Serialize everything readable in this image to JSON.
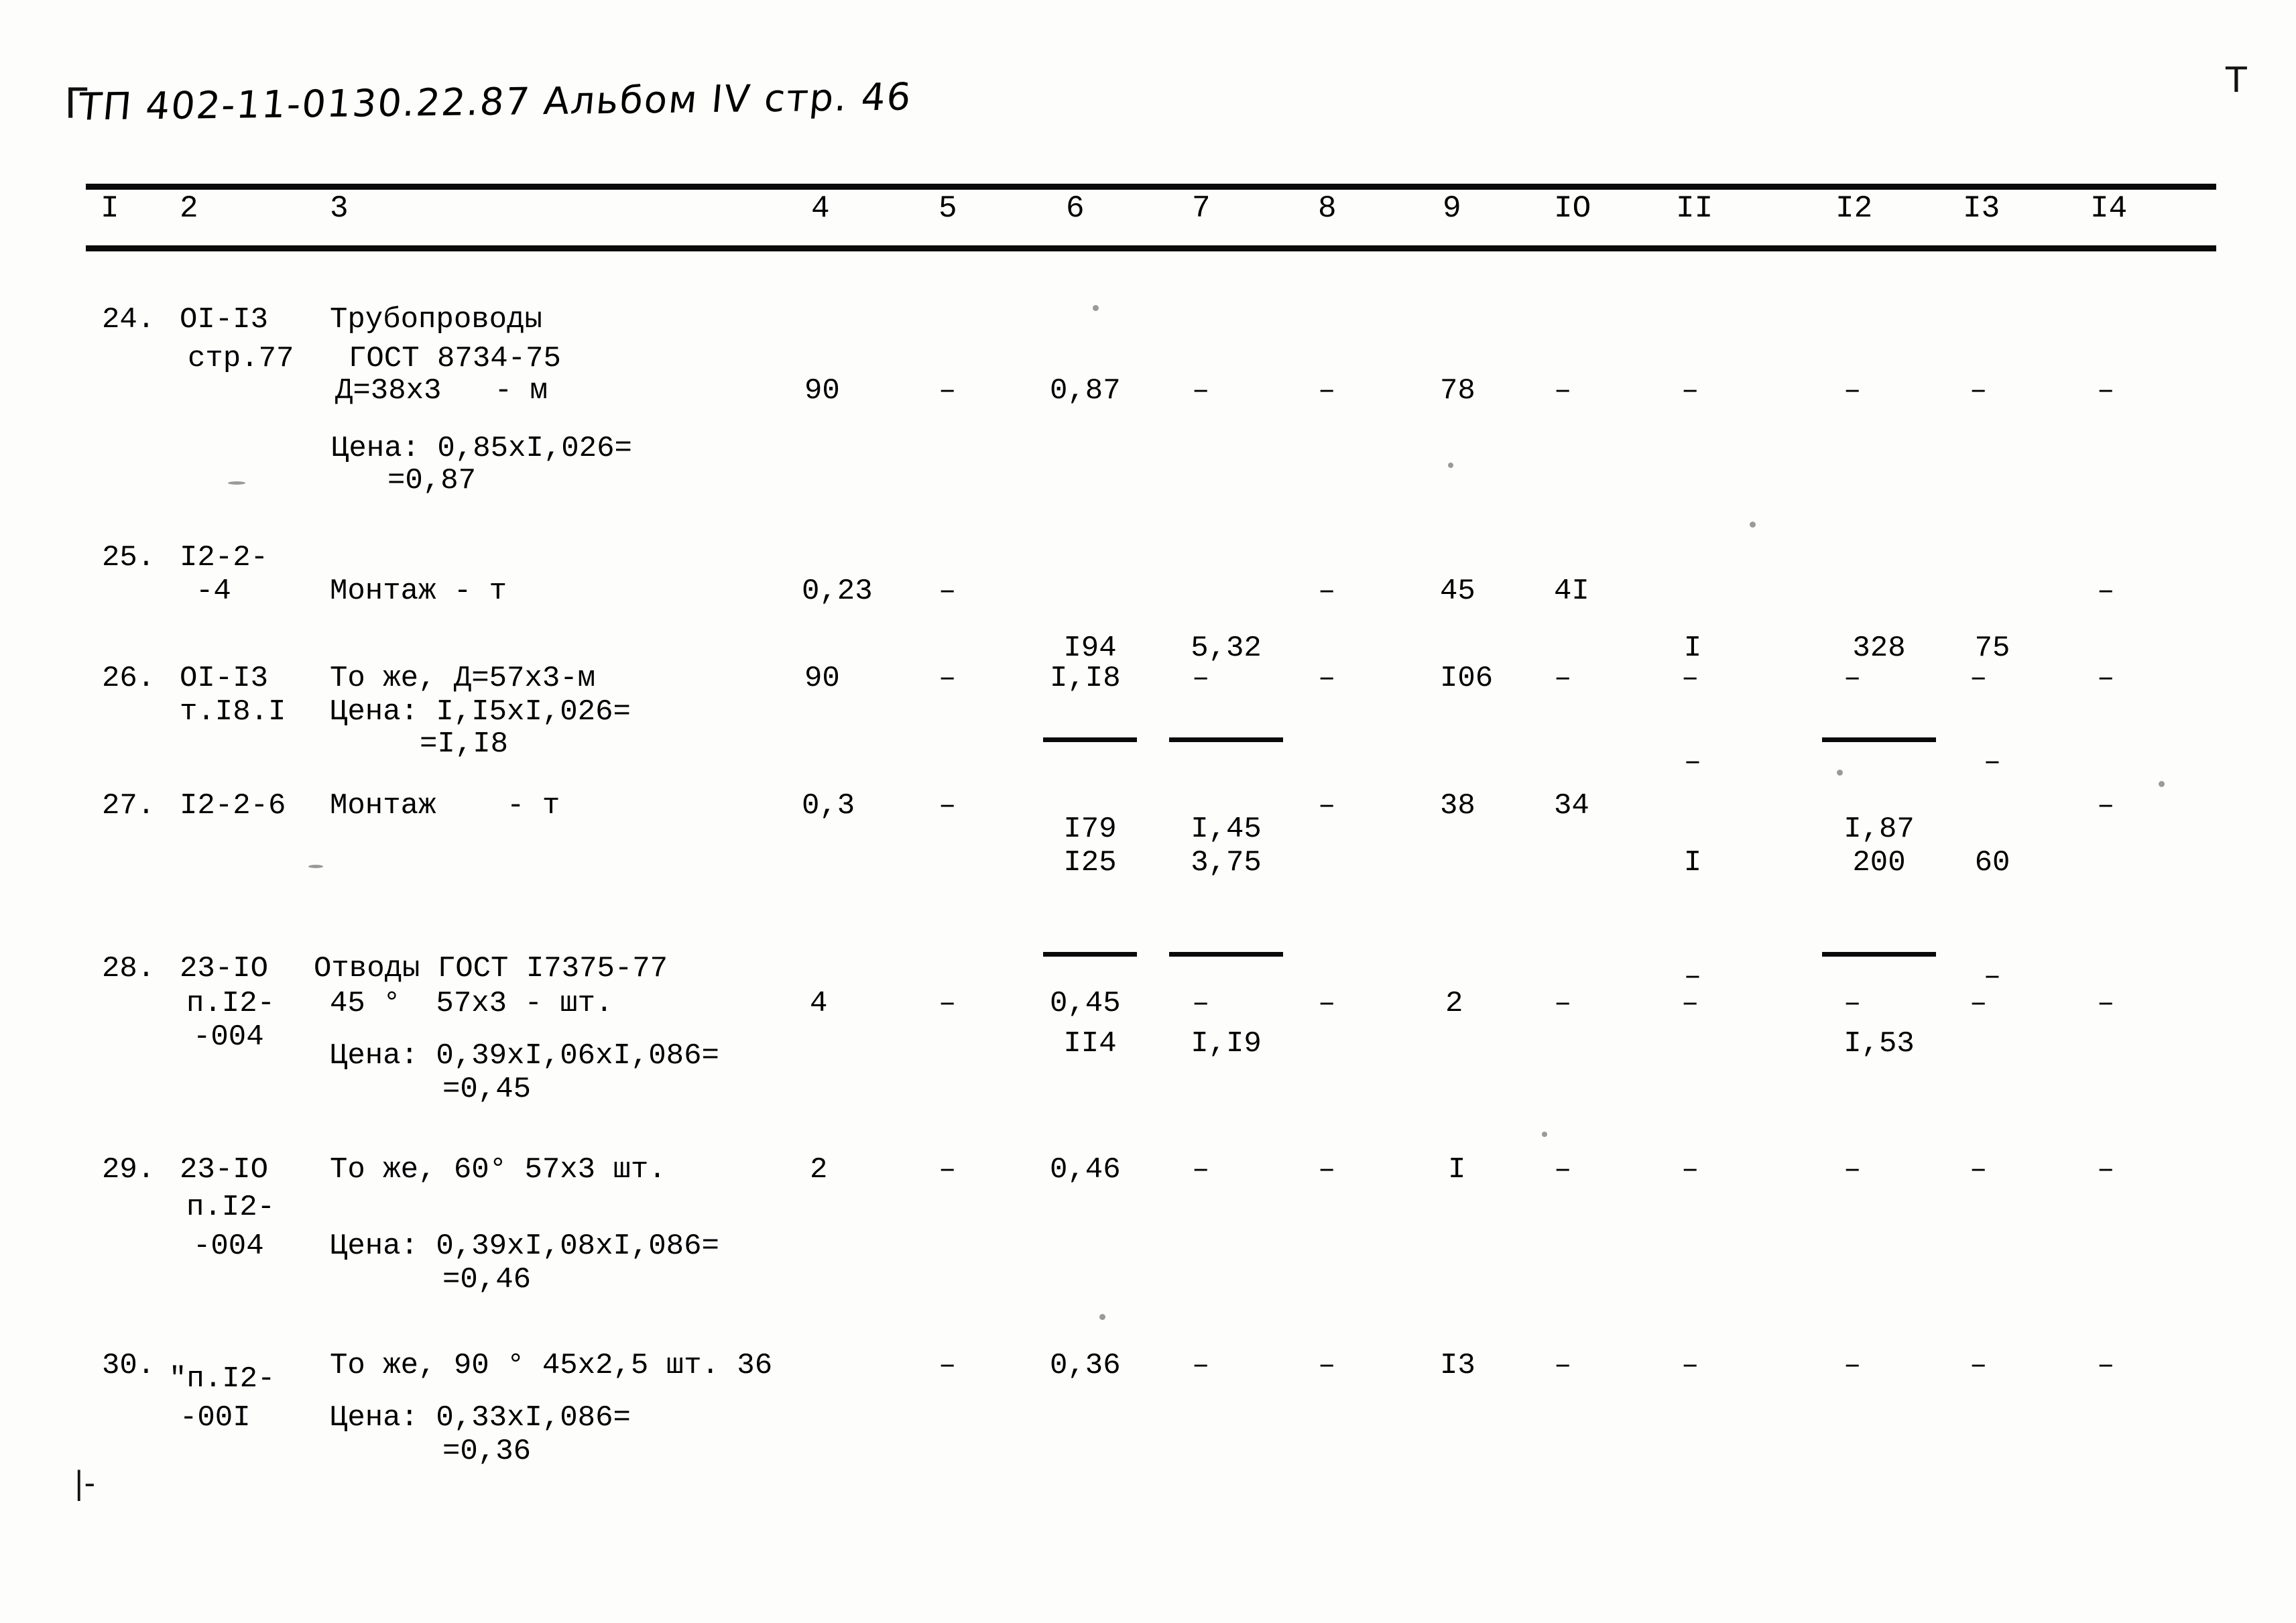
{
  "page": {
    "handwritten_header": "ТП 402-11-0130.22.87 Альбом IV стр. 46",
    "corner_top_left": "Г",
    "corner_top_right": "Т",
    "corner_bottom_left": "|-"
  },
  "table": {
    "column_headers": [
      "I",
      "2",
      "3",
      "4",
      "5",
      "6",
      "7",
      "8",
      "9",
      "IO",
      "II",
      "I2",
      "I3",
      "I4"
    ],
    "rows": [
      {
        "num": "24.",
        "code_lines": [
          "OI-I3",
          "стр.77"
        ],
        "desc_lines": [
          "Трубопроводы",
          "ГОСТ 8734-75",
          "Д=38х3   - м"
        ],
        "price_lines": [
          "Цена: 0,85xI,026=",
          "=0,87"
        ],
        "c4": "90",
        "c5": "–",
        "c6": "0,87",
        "c7": "–",
        "c8": "–",
        "c9": "78",
        "c10": "–",
        "c11": "–",
        "c12": "–",
        "c13": "–",
        "c14": "–"
      },
      {
        "num": "25.",
        "code_lines": [
          "I2-2-",
          "-4"
        ],
        "desc_lines": [
          "Монтаж - т"
        ],
        "price_lines": [],
        "c4": "0,23",
        "c5": "–",
        "c6_top": "I94",
        "c6_bot": "I79",
        "c7_top": "5,32",
        "c7_bot": "I,45",
        "c8": "–",
        "c9": "45",
        "c10": "4I",
        "c11_top": "I",
        "c11_bot": "–",
        "c12_top": "328",
        "c12_bot": "I,87",
        "c13_top": "75",
        "c13_bot": "–",
        "c14": "–"
      },
      {
        "num": "26.",
        "code_lines": [
          "OI-I3",
          "т.I8.I"
        ],
        "desc_lines": [
          "То же, Д=57х3-м",
          "Цена: I,I5xI,026=",
          "=I,I8"
        ],
        "price_lines": [],
        "c4": "90",
        "c5": "–",
        "c6": "I,I8",
        "c7": "–",
        "c8": "–",
        "c9": "I06",
        "c10": "–",
        "c11": "–",
        "c12": "–",
        "c13": "–",
        "c14": "–"
      },
      {
        "num": "27.",
        "code_lines": [
          "I2-2-6"
        ],
        "desc_lines": [
          "Монтаж    - т"
        ],
        "price_lines": [],
        "c4": "0,3",
        "c5": "–",
        "c6_top": "I25",
        "c6_bot": "II4",
        "c7_top": "3,75",
        "c7_bot": "I,I9",
        "c8": "–",
        "c9": "38",
        "c10": "34",
        "c11_top": "I",
        "c11_bot": "–",
        "c12_top": "200",
        "c12_bot": "I,53",
        "c13_top": "60",
        "c13_bot": "–",
        "c14": "–"
      },
      {
        "num": "28.",
        "code_lines": [
          "23-IO",
          "п.I2-",
          "-004"
        ],
        "desc_lines": [
          "Отводы ГОСТ I7375-77",
          "45 °  57х3 - шт."
        ],
        "price_lines": [
          "Цена: 0,39xI,06xI,086=",
          "=0,45"
        ],
        "c4": "4",
        "c5": "–",
        "c6": "0,45",
        "c7": "–",
        "c8": "–",
        "c9": "2",
        "c10": "–",
        "c11": "–",
        "c12": "–",
        "c13": "–",
        "c14": "–"
      },
      {
        "num": "29.",
        "code_lines": [
          "23-IO",
          "п.I2-",
          "-004"
        ],
        "desc_lines": [
          "То же, 60° 57х3 шт."
        ],
        "price_lines": [
          "Цена: 0,39xI,08xI,086=",
          "=0,46"
        ],
        "c4": "2",
        "c5": "–",
        "c6": "0,46",
        "c7": "–",
        "c8": "–",
        "c9": "I",
        "c10": "–",
        "c11": "–",
        "c12": "–",
        "c13": "–",
        "c14": "–"
      },
      {
        "num": "30.",
        "code_lines": [
          "\"п.I2-",
          "-00I"
        ],
        "desc_lines": [
          "То же, 90 ° 45х2,5 шт. 36"
        ],
        "price_lines": [
          "Цена: 0,33xI,086=",
          "=0,36"
        ],
        "c4": "",
        "c5": "–",
        "c6": "0,36",
        "c7": "–",
        "c8": "–",
        "c9": "I3",
        "c10": "–",
        "c11": "–",
        "c12": "–",
        "c13": "–",
        "c14": "–"
      }
    ]
  }
}
